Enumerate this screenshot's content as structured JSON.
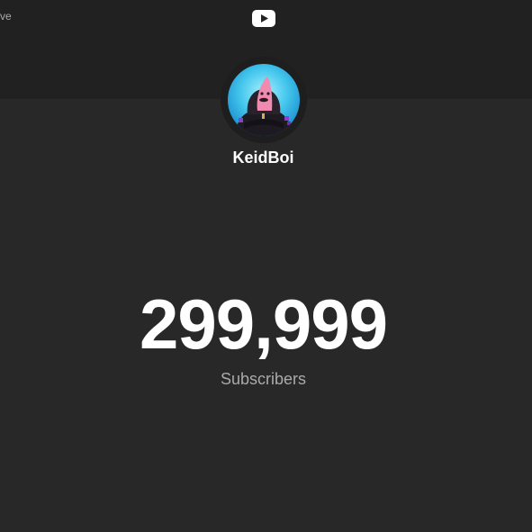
{
  "header": {
    "corner_text": "ve",
    "logo_icon": "youtube-play-icon"
  },
  "channel": {
    "name": "KeidBoi",
    "avatar_icon": "channel-avatar"
  },
  "stats": {
    "subscriber_count": "299,999",
    "subscriber_label": "Subscribers"
  },
  "colors": {
    "background": "#282828",
    "header_band": "#212121",
    "text_primary": "#ffffff",
    "text_secondary": "#aaaaaa"
  }
}
